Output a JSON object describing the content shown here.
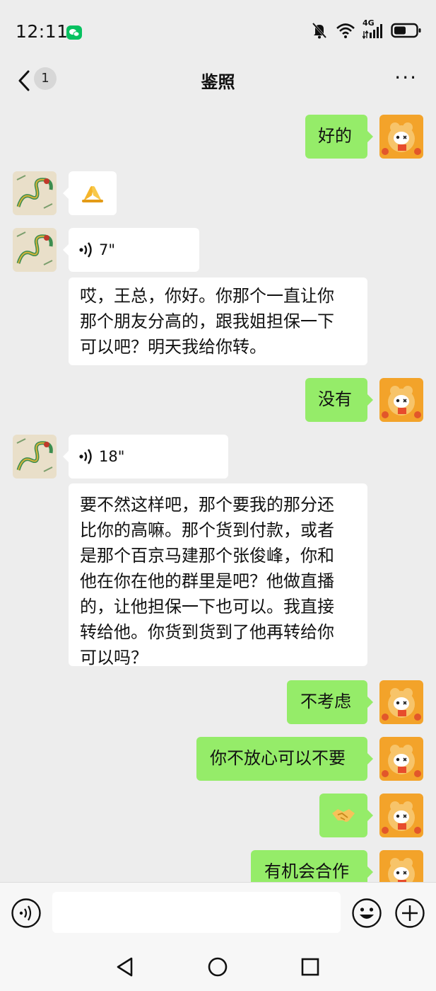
{
  "status_bar": {
    "time": "12:11",
    "network": "4G"
  },
  "header": {
    "back_count": "1",
    "title": "鉴照",
    "more_label": "···"
  },
  "colors": {
    "background": "#ededed",
    "my_bubble": "#95ec69",
    "other_bubble": "#ffffff",
    "wechat_green": "#07c160"
  },
  "messages": [
    {
      "sender": "me",
      "type": "text",
      "text": "好的"
    },
    {
      "sender": "other",
      "type": "emoji",
      "icon": "folded-hands-icon"
    },
    {
      "sender": "other",
      "type": "voice",
      "duration": "7\""
    },
    {
      "sender": "other",
      "type": "text",
      "lines": [
        "哎，王总，你好。你那个一直让你",
        "那个朋友分高的，跟我姐担保一下",
        "可以吧？明天我给你转。"
      ]
    },
    {
      "sender": "me",
      "type": "text",
      "text": "没有"
    },
    {
      "sender": "other",
      "type": "voice",
      "duration": "18\""
    },
    {
      "sender": "other",
      "type": "text",
      "lines": [
        "要不然这样吧，那个要我的那分还",
        "比你的高嘛。那个货到付款，或者",
        "是那个百京马建那个张俊峰，你和",
        "他在你在他的群里是吧？他做直播",
        "的，让他担保一下也可以。我直接",
        "转给他。你货到货到了他再转给你",
        "可以吗？"
      ]
    },
    {
      "sender": "me",
      "type": "text",
      "text": "不考虑"
    },
    {
      "sender": "me",
      "type": "text",
      "text": "你不放心可以不要"
    },
    {
      "sender": "me",
      "type": "emoji",
      "icon": "handshake-icon"
    },
    {
      "sender": "me",
      "type": "text",
      "text": "有机会合作"
    }
  ],
  "input_bar": {
    "voice_icon": "voice-input-icon",
    "emoji_icon": "emoji-icon",
    "plus_icon": "plus-icon"
  },
  "system_nav": {
    "back": "back-triangle-icon",
    "home": "home-circle-icon",
    "recent": "recent-square-icon"
  }
}
